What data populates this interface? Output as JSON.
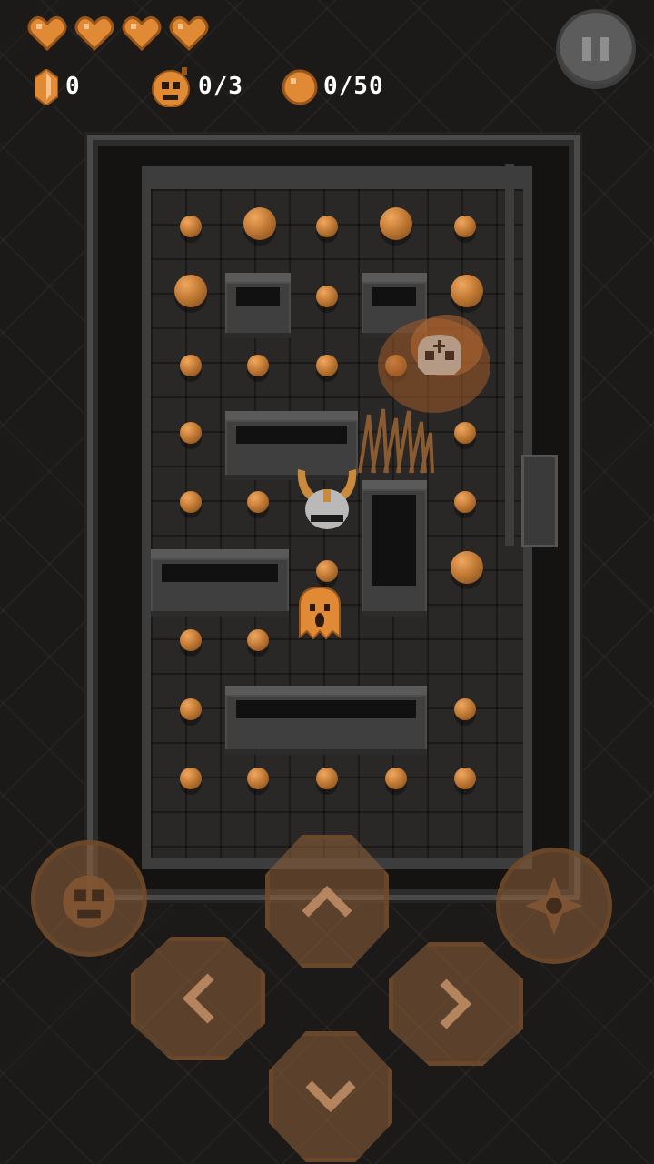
{
  "hud": {
    "hearts": 4,
    "gem_count": "0",
    "skull_count": "0/3",
    "coin_count": "0/50"
  },
  "icons": {
    "heart": "heart-icon",
    "gem": "gem-icon",
    "skull": "skull-bomb-icon",
    "coin": "coin-icon",
    "pause": "pause-icon"
  },
  "colors": {
    "accent": "#e08a36",
    "coin": "#c27a35",
    "wall": "#3d3d3d",
    "floor": "#2a2827"
  },
  "controls": {
    "up": "arrow-up",
    "down": "arrow-down",
    "left": "arrow-left",
    "right": "arrow-right",
    "bomb": "skull-bomb",
    "attack": "shuriken"
  }
}
